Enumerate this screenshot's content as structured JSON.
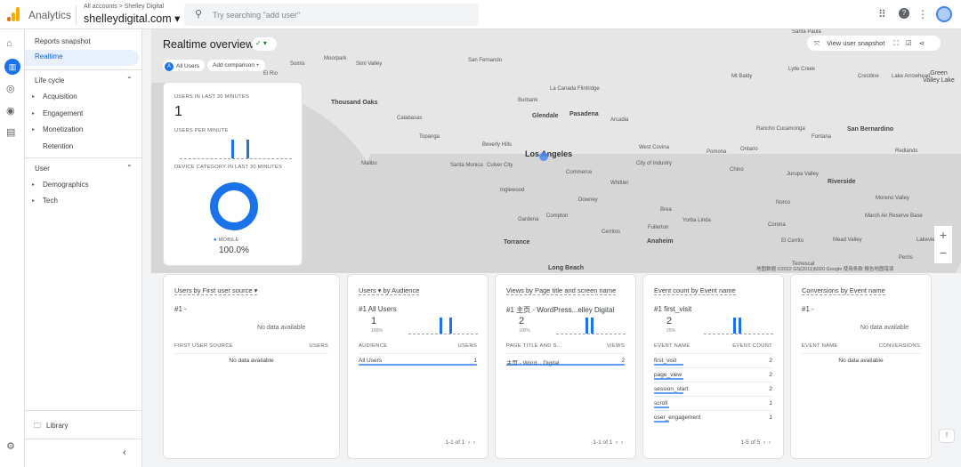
{
  "topbar": {
    "app": "Analytics",
    "breadcrumb": "All accounts > Shelley Digital",
    "property": "shelleydigital.com ▾",
    "search_placeholder": "Try searching \"add user\""
  },
  "nav": {
    "reports_snapshot": "Reports snapshot",
    "realtime": "Realtime",
    "lifecycle": "Life cycle",
    "acquisition": "Acquisition",
    "engagement": "Engagement",
    "monetization": "Monetization",
    "retention": "Retention",
    "user": "User",
    "demographics": "Demographics",
    "tech": "Tech",
    "library": "Library"
  },
  "header": {
    "title": "Realtime overview",
    "all_users": "All Users",
    "add_comparison": "Add comparison +",
    "view_snapshot": "View user snapshot"
  },
  "map": {
    "labels": [
      "Santa Paula",
      "Somis",
      "El Rio",
      "Moorpark",
      "Simi Valley",
      "San Fernando",
      "Thousand Oaks",
      "Calabasas",
      "Burbank",
      "La Canada Flintridge",
      "Glendale",
      "Pasadena",
      "Arcadia",
      "Topanga",
      "Beverly Hills",
      "Los Angeles",
      "Santa Monica",
      "Culver City",
      "Malibu",
      "Inglewood",
      "Commerce",
      "Whittier",
      "West Covina",
      "City of Industry",
      "Downey",
      "Compton",
      "Gardena",
      "Torrance",
      "Cerritos",
      "Long Beach",
      "Brea",
      "Fullerton",
      "Anaheim",
      "Yorba Linda",
      "Pomona",
      "Ontario",
      "Chino",
      "Rancho Cucamonga",
      "Fontana",
      "San Bernardino",
      "Riverside",
      "Jurupa Valley",
      "Norco",
      "Corona",
      "El Cerrito",
      "Mead Valley",
      "Moreno Valley",
      "March Air Reserve Base",
      "Redlands",
      "Lytle Creek",
      "Mt Baldy",
      "Crestline",
      "Lake Arrowhead",
      "Green Valley Lake",
      "Perris",
      "Lakeview",
      "Temescal"
    ],
    "attribution": "地图数据 ©2022 GS(2011)6020 Google   使用条款   报告地图错误"
  },
  "overview": {
    "users_30_label": "USERS IN LAST 30 MINUTES",
    "users_30": "1",
    "per_minute_label": "USERS PER MINUTE",
    "device_label": "DEVICE CATEGORY IN LAST 30 MINUTES",
    "device": "MOBILE",
    "device_pct": "100.0%",
    "device_share": 1.0
  },
  "cards": [
    {
      "title": "Users by First user source ▾",
      "rank": "#1  -",
      "no_data": "No data available",
      "col1": "FIRST USER SOURCE",
      "col2": "USERS",
      "table_empty": "No data available"
    },
    {
      "title": "Users ▾  by Audience",
      "rank": "#1  All Users",
      "value": "1",
      "pct": "100%",
      "col1": "AUDIENCE",
      "col2": "USERS",
      "rows": [
        {
          "name": "All Users",
          "value": "1"
        }
      ],
      "pager": "1-1 of 1"
    },
    {
      "title": "Views by Page title and screen name",
      "rank": "#1  主页 - WordPress...elley Digital",
      "value": "2",
      "pct": "100%",
      "col1": "PAGE TITLE AND S...",
      "col2": "VIEWS",
      "rows": [
        {
          "name": "主页 - Word... Digital",
          "value": "2"
        }
      ],
      "pager": "1-1 of 1"
    },
    {
      "title": "Event count by Event name",
      "rank": "#1  first_visit",
      "value": "2",
      "pct": "25%",
      "col1": "EVENT NAME",
      "col2": "EVENT COUNT",
      "rows": [
        {
          "name": "first_visit",
          "value": "2"
        },
        {
          "name": "page_view",
          "value": "2"
        },
        {
          "name": "session_start",
          "value": "2"
        },
        {
          "name": "scroll",
          "value": "1"
        },
        {
          "name": "user_engagement",
          "value": "1"
        }
      ],
      "pager": "1-5 of 5"
    },
    {
      "title": "Conversions by Event name",
      "rank": "#1  -",
      "no_data": "No data available",
      "col1": "EVENT NAME",
      "col2": "CONVERSIONS",
      "table_empty": "No data available"
    }
  ],
  "colors": {
    "accent": "#1a73e8",
    "logo": "#f9ab00"
  }
}
